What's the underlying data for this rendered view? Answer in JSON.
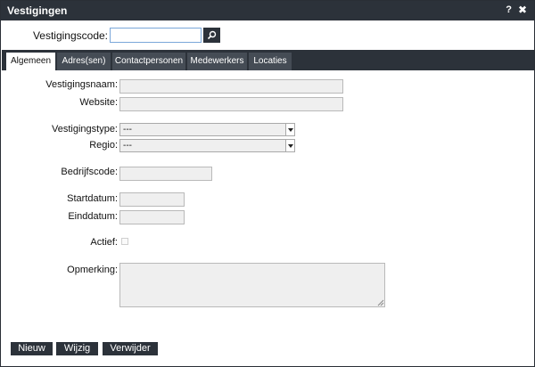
{
  "window": {
    "title": "Vestigingen",
    "help_label": "?",
    "close_label": "✖"
  },
  "search": {
    "label": "Vestigingscode:",
    "value": "",
    "button_icon": "search-icon"
  },
  "tabs": [
    {
      "label": "Algemeen",
      "active": true
    },
    {
      "label": "Adres(sen)",
      "active": false
    },
    {
      "label": "Contactpersonen",
      "active": false
    },
    {
      "label": "Medewerkers",
      "active": false
    },
    {
      "label": "Locaties",
      "active": false
    }
  ],
  "form": {
    "vestigingsnaam": {
      "label": "Vestigingsnaam:",
      "value": ""
    },
    "website": {
      "label": "Website:",
      "value": ""
    },
    "vestigingstype": {
      "label": "Vestigingstype:",
      "selected": "---"
    },
    "regio": {
      "label": "Regio:",
      "selected": "---"
    },
    "bedrijfscode": {
      "label": "Bedrijfscode:",
      "value": ""
    },
    "startdatum": {
      "label": "Startdatum:",
      "value": ""
    },
    "einddatum": {
      "label": "Einddatum:",
      "value": ""
    },
    "actief": {
      "label": "Actief:",
      "checked": false
    },
    "opmerking": {
      "label": "Opmerking:",
      "value": ""
    }
  },
  "actions": {
    "new_label": "Nieuw",
    "edit_label": "Wijzig",
    "delete_label": "Verwijder"
  },
  "colors": {
    "chrome": "#2c323a",
    "tab_inactive": "#454c55",
    "field_bg": "#efefef",
    "focus_border": "#7aa7d9"
  }
}
